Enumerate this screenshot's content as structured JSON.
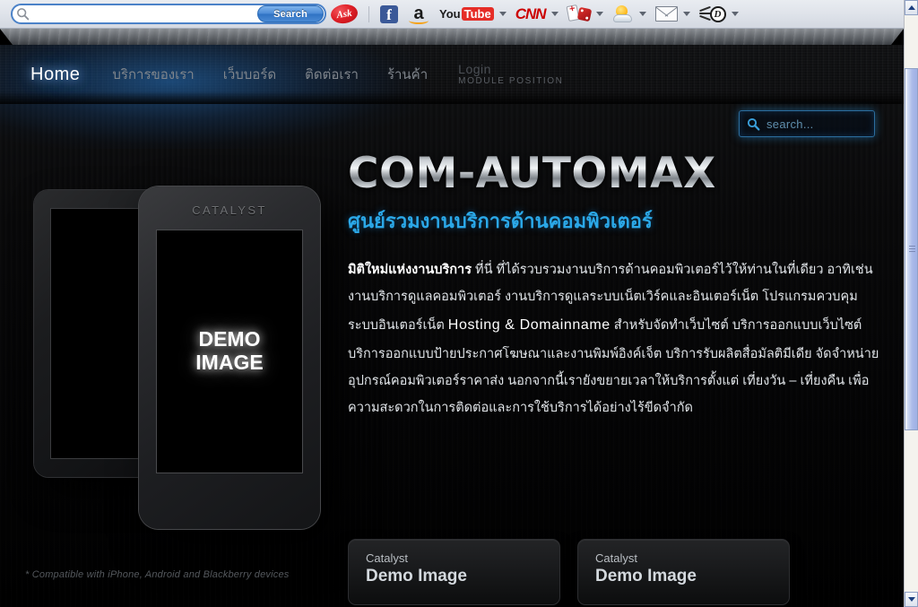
{
  "browser": {
    "search": {
      "value": "",
      "placeholder": "",
      "button_label": "Search",
      "icon": "search-icon"
    },
    "toolbar_items": [
      {
        "name": "ask",
        "label": "Ask",
        "icon": "ask-logo-icon",
        "has_caret": false
      },
      {
        "name": "facebook",
        "label": "f",
        "icon": "facebook-icon",
        "has_caret": false
      },
      {
        "name": "amazon",
        "label": "a",
        "icon": "amazon-icon",
        "has_caret": false
      },
      {
        "name": "youtube",
        "label_you": "You",
        "label_tube": "Tube",
        "icon": "youtube-icon",
        "has_caret": true
      },
      {
        "name": "cnn",
        "label": "CNN",
        "icon": "cnn-icon",
        "has_caret": true
      },
      {
        "name": "games",
        "label": "",
        "icon": "cards-dice-icon",
        "has_caret": true
      },
      {
        "name": "weather",
        "label": "",
        "icon": "sun-cloud-icon",
        "has_caret": true
      },
      {
        "name": "mail",
        "label": "",
        "icon": "envelope-icon",
        "has_caret": true
      },
      {
        "name": "dogpile",
        "label": "D",
        "icon": "dogpile-d-icon",
        "has_caret": true
      }
    ],
    "scrollbar": {
      "up_icon": "chevron-up-icon",
      "down_icon": "chevron-down-icon"
    }
  },
  "site": {
    "nav": {
      "home": "Home",
      "items": [
        {
          "label": "บริการของเรา"
        },
        {
          "label": "เว็บบอร์ด"
        },
        {
          "label": "ติดต่อเรา"
        },
        {
          "label": "ร้านค้า"
        }
      ],
      "module": {
        "login": "Login",
        "position": "MODULE POSITION"
      }
    },
    "search": {
      "placeholder": "search...",
      "icon": "search-icon"
    },
    "devices": {
      "phone": {
        "brand": "CATALYST",
        "screen_line1": "DEMO",
        "screen_line2": "IMAGE"
      },
      "compat_note": "* Compatible with iPhone, Android and Blackberry devices"
    },
    "hero": {
      "headline": "COM-AUTOMAX",
      "subhead": "ศูนย์รวมงานบริการด้านคอมพิวเตอร์",
      "paragraph": {
        "lead": "มิติใหม่แห่งงานบริการ",
        "part1": " ที่นี่  ที่ได้รวบรวมงานบริการด้านคอมพิวเตอร์ไว้ให้ท่านในที่เดียว อาทิเช่น  งานบริการดูแลคอมพิวเตอร์ งานบริการดูแลระบบเน็ตเวิร์คและอินเตอร์เน็ต โปรแกรมควบคุมระบบอินเตอร์เน็ต  ",
        "highlight": "Hosting & Domainname",
        "part2": " สำหรับจัดทำเว็บไซต์ บริการออกแบบเว็บไซต์  บริการออกแบบป้ายประกาศโฆษณาและงานพิมพ์อิงค์เจ็ต  บริการรับผลิตสื่อมัลติมีเดีย  จัดจำหน่ายอุปกรณ์คอมพิวเตอร์ราคาส่ง  นอกจากนี้เรายังขยายเวลาให้บริการตั้งแต่  เที่ยงวัน – เที่ยงคืน เพื่อความสะดวกในการติดต่อและการใช้บริการได้อย่างไร้ขีดจำกัด"
      }
    },
    "demo_boxes": [
      {
        "kicker": "Catalyst",
        "title": "Demo Image"
      },
      {
        "kicker": "Catalyst",
        "title": "Demo Image"
      }
    ]
  },
  "colors": {
    "accent_cyan": "#2ba8e8",
    "nav_glow_blue": "#2470be",
    "browser_blue": "#4b8bd6",
    "page_black": "#000000"
  }
}
